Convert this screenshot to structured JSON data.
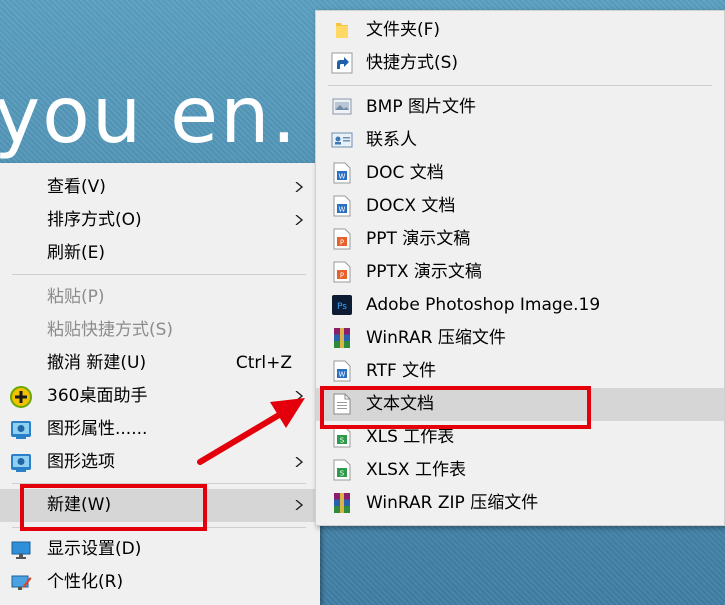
{
  "wallpaper": {
    "text": "you en."
  },
  "context_menu": {
    "items": [
      {
        "label": "查看(V)"
      },
      {
        "label": "排序方式(O)"
      },
      {
        "label": "刷新(E)"
      },
      {
        "label": "粘贴(P)"
      },
      {
        "label": "粘贴快捷方式(S)"
      },
      {
        "label": "撤消 新建(U)",
        "shortcut": "Ctrl+Z"
      },
      {
        "label": "360桌面助手"
      },
      {
        "label": "图形属性......"
      },
      {
        "label": "图形选项"
      },
      {
        "label": "新建(W)"
      },
      {
        "label": "显示设置(D)"
      },
      {
        "label": "个性化(R)"
      }
    ]
  },
  "new_submenu": {
    "items": [
      {
        "label": "文件夹(F)",
        "icon": "folder-icon"
      },
      {
        "label": "快捷方式(S)",
        "icon": "shortcut-icon"
      },
      {
        "label": "BMP 图片文件",
        "icon": "bmp-file-icon"
      },
      {
        "label": "联系人",
        "icon": "contact-icon"
      },
      {
        "label": "DOC 文档",
        "icon": "word-doc-icon"
      },
      {
        "label": "DOCX 文档",
        "icon": "word-docx-icon"
      },
      {
        "label": "PPT 演示文稿",
        "icon": "ppt-icon"
      },
      {
        "label": "PPTX 演示文稿",
        "icon": "pptx-icon"
      },
      {
        "label": "Adobe Photoshop Image.19",
        "icon": "photoshop-icon"
      },
      {
        "label": "WinRAR 压缩文件",
        "icon": "winrar-icon"
      },
      {
        "label": "RTF 文件",
        "icon": "rtf-icon"
      },
      {
        "label": "文本文档",
        "icon": "text-document-icon"
      },
      {
        "label": "XLS 工作表",
        "icon": "xls-icon"
      },
      {
        "label": "XLSX 工作表",
        "icon": "xlsx-icon"
      },
      {
        "label": "WinRAR ZIP 压缩文件",
        "icon": "winrar-zip-icon"
      }
    ]
  },
  "colors": {
    "highlight_box": "#e3000b",
    "menu_bg": "#f0f0f0",
    "hover_bg": "#d6d6d6"
  }
}
